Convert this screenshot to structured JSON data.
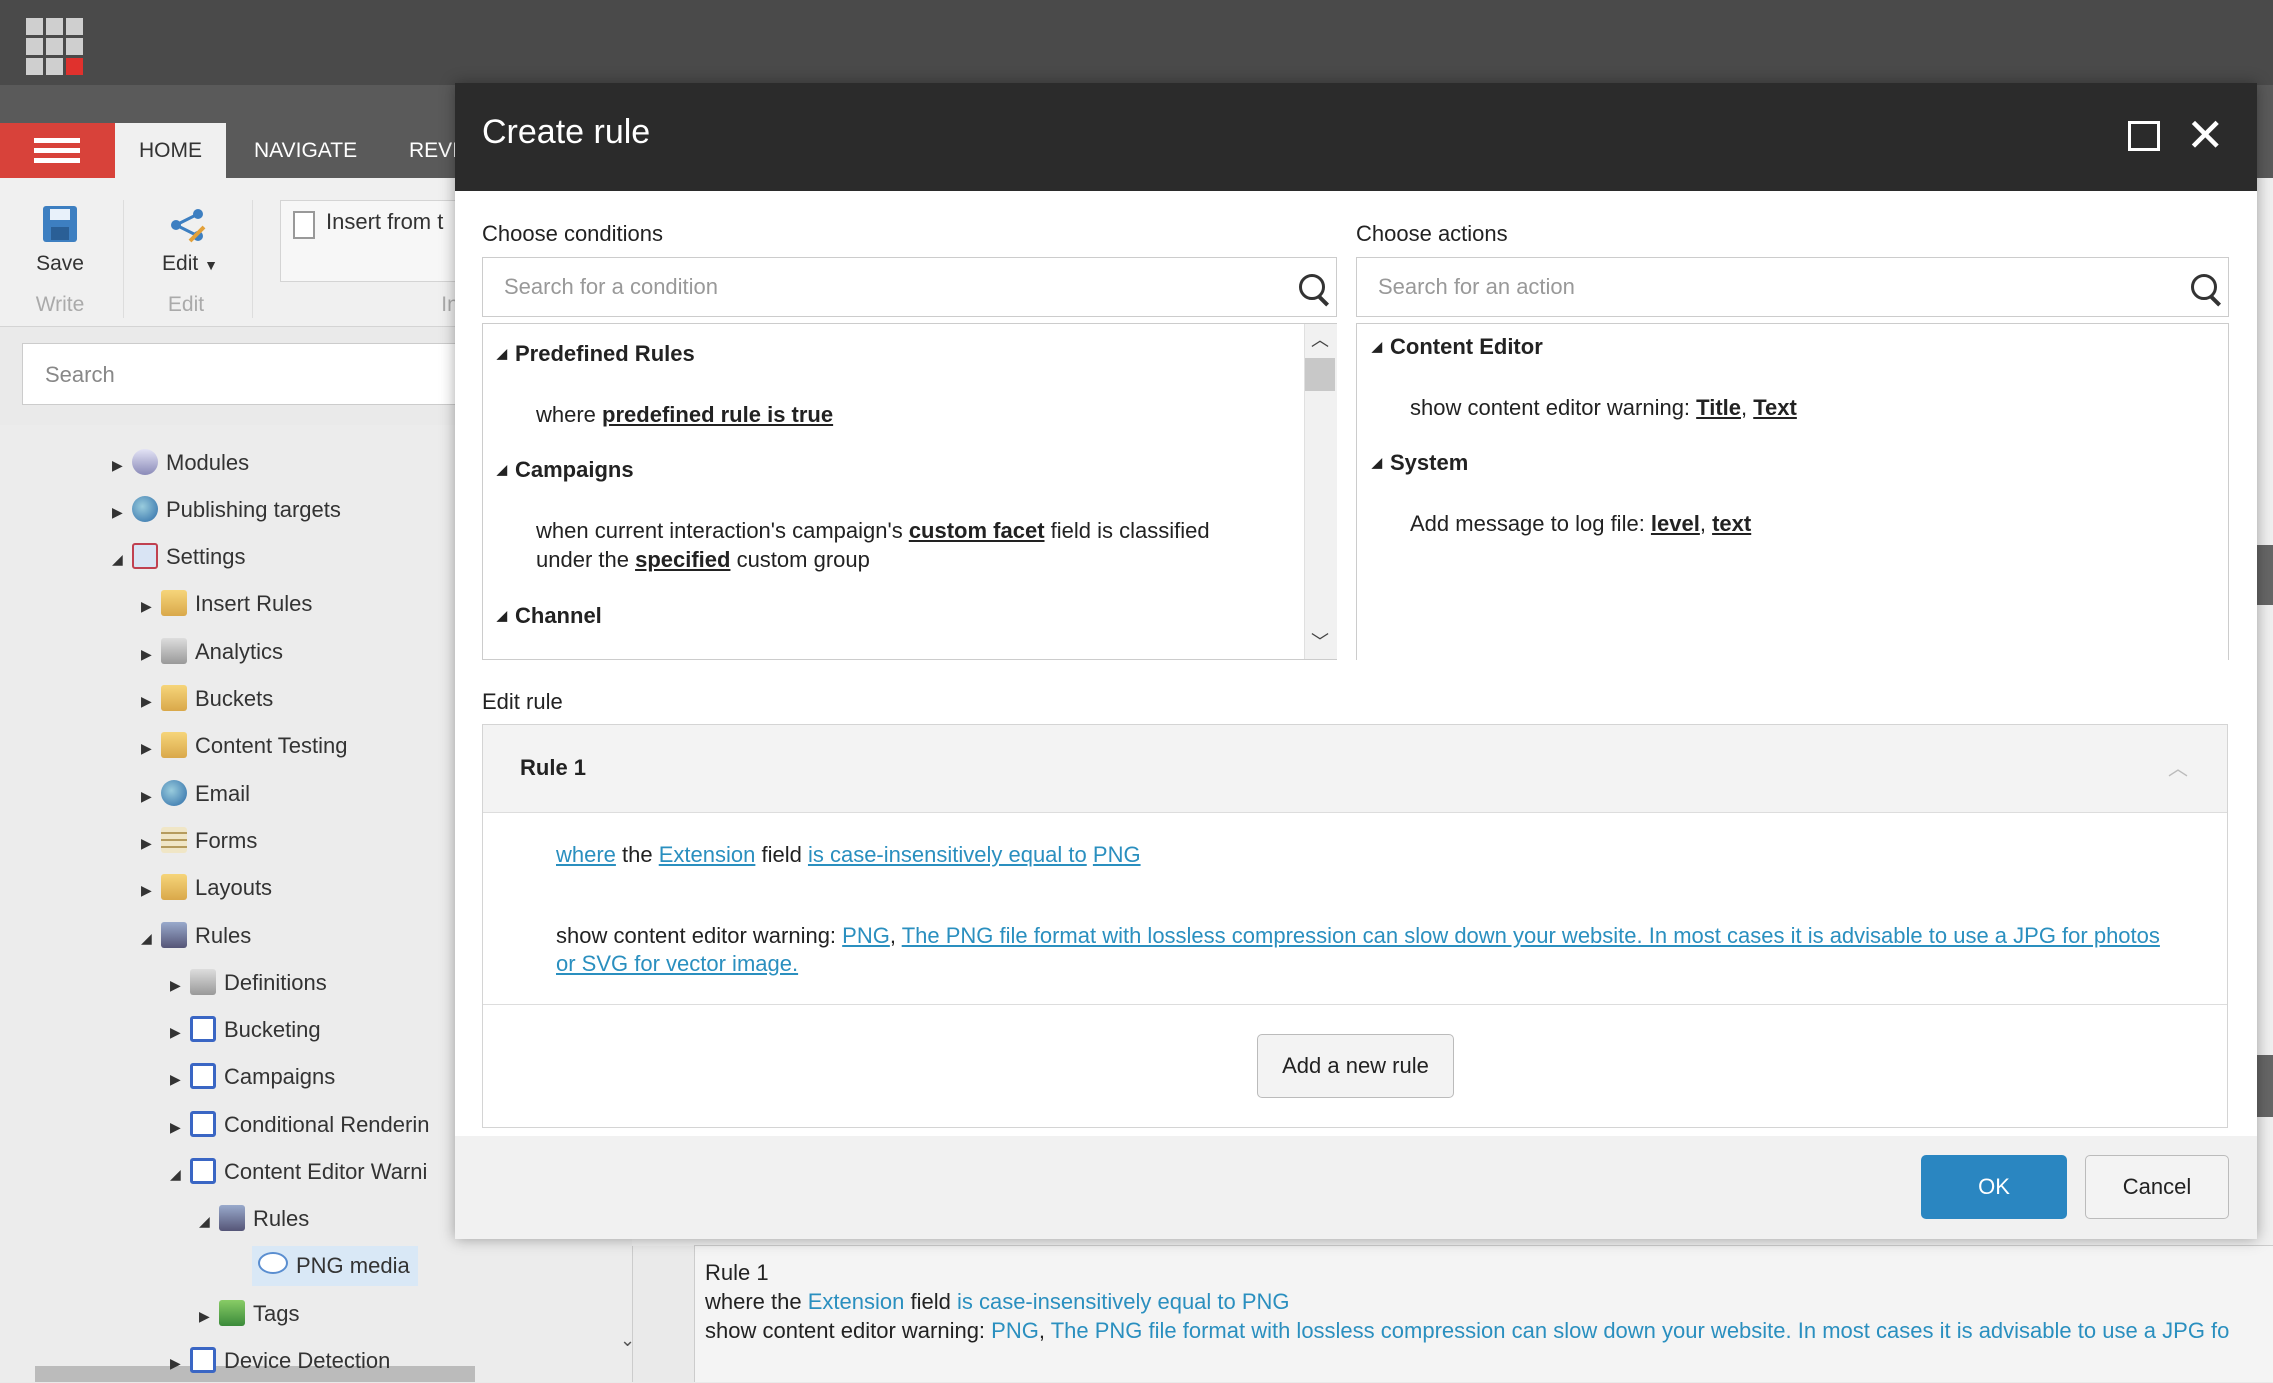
{
  "top_bar": {
    "apps_icon": "app-grid-icon"
  },
  "ribbon": {
    "tabs": [
      "HOME",
      "NAVIGATE",
      "REVI"
    ],
    "save_label": "Save",
    "write_caption": "Write",
    "edit_label": "Edit",
    "edit_caption": "Edit",
    "insert_label": "Insert from t",
    "insert_caption": "In"
  },
  "sidebar": {
    "search_placeholder": "Search",
    "tree": [
      {
        "label": "Modules",
        "icon": "module-icon"
      },
      {
        "label": "Publishing targets",
        "icon": "globe-icon"
      },
      {
        "label": "Settings",
        "icon": "settings-icon"
      },
      {
        "label": "Insert Rules",
        "icon": "folder-icon"
      },
      {
        "label": "Analytics",
        "icon": "analytics-icon"
      },
      {
        "label": "Buckets",
        "icon": "folder-icon"
      },
      {
        "label": "Content Testing",
        "icon": "folder-icon"
      },
      {
        "label": "Email",
        "icon": "email-icon"
      },
      {
        "label": "Forms",
        "icon": "forms-icon"
      },
      {
        "label": "Layouts",
        "icon": "folder-icon"
      },
      {
        "label": "Rules",
        "icon": "rules-icon"
      },
      {
        "label": "Definitions",
        "icon": "wrench-icon"
      },
      {
        "label": "Bucketing",
        "icon": "element-icon"
      },
      {
        "label": "Campaigns",
        "icon": "element-icon"
      },
      {
        "label": "Conditional Renderin",
        "icon": "element-icon"
      },
      {
        "label": "Content Editor Warni",
        "icon": "element-icon"
      },
      {
        "label": "Rules",
        "icon": "rule-icon"
      },
      {
        "label": "PNG media",
        "icon": "oval-icon"
      },
      {
        "label": "Tags",
        "icon": "tag-icon"
      },
      {
        "label": "Device Detection",
        "icon": "element-icon"
      }
    ]
  },
  "preview": {
    "line1": "Rule 1",
    "line2_prefix": "where the ",
    "line2_field": "Extension",
    "line2_mid": " field ",
    "line2_op": "is case-insensitively equal to PNG",
    "line3_prefix": "show content editor warning: ",
    "line3_title": "PNG",
    "line3_sep": ", ",
    "line3_text": "The PNG file format with lossless compression can slow down your website. In most cases it is advisable to use a JPG fo"
  },
  "modal": {
    "title": "Create rule",
    "conditions": {
      "label": "Choose conditions",
      "placeholder": "Search for a condition",
      "groups": [
        {
          "name": "Predefined Rules"
        },
        {
          "name": "Campaigns"
        },
        {
          "name": "Channel"
        }
      ],
      "item1_prefix": "where ",
      "item1_link": "predefined rule is true",
      "item2_prefix": "when current interaction's campaign's ",
      "item2_link1": "custom facet",
      "item2_mid": " field is classified",
      "item2_line2_prefix": "under the ",
      "item2_link2": "specified",
      "item2_suffix": " custom group"
    },
    "actions": {
      "label": "Choose actions",
      "placeholder": "Search for an action",
      "group1": "Content Editor",
      "item1_prefix": "show content editor warning: ",
      "item1_link1": "Title",
      "item1_sep": ", ",
      "item1_link2": "Text",
      "group2": "System",
      "item2_prefix": "Add message to log file: ",
      "item2_link1": "level",
      "item2_sep": ", ",
      "item2_link2": "text"
    },
    "edit_rule": {
      "label": "Edit rule",
      "rule_title": "Rule 1",
      "cond_where": "where",
      "cond_the": " the ",
      "cond_field": "Extension",
      "cond_field_word": " field ",
      "cond_op": "is case-insensitively equal to",
      "cond_space": " ",
      "cond_value": "PNG",
      "action_prefix": "show content editor warning: ",
      "action_title": "PNG",
      "action_sep": ", ",
      "action_text_line1": "The PNG file format with lossless compression can slow down your website. In most cases it is advisable to use a JPG for photos",
      "action_text_line2": "or SVG for vector image.",
      "add_rule_button": "Add a new rule"
    },
    "ok_button": "OK",
    "cancel_button": "Cancel",
    "colors": {
      "ok": "#2a86c1",
      "header": "#2b2b2b",
      "link": "#2a8fbf"
    }
  }
}
